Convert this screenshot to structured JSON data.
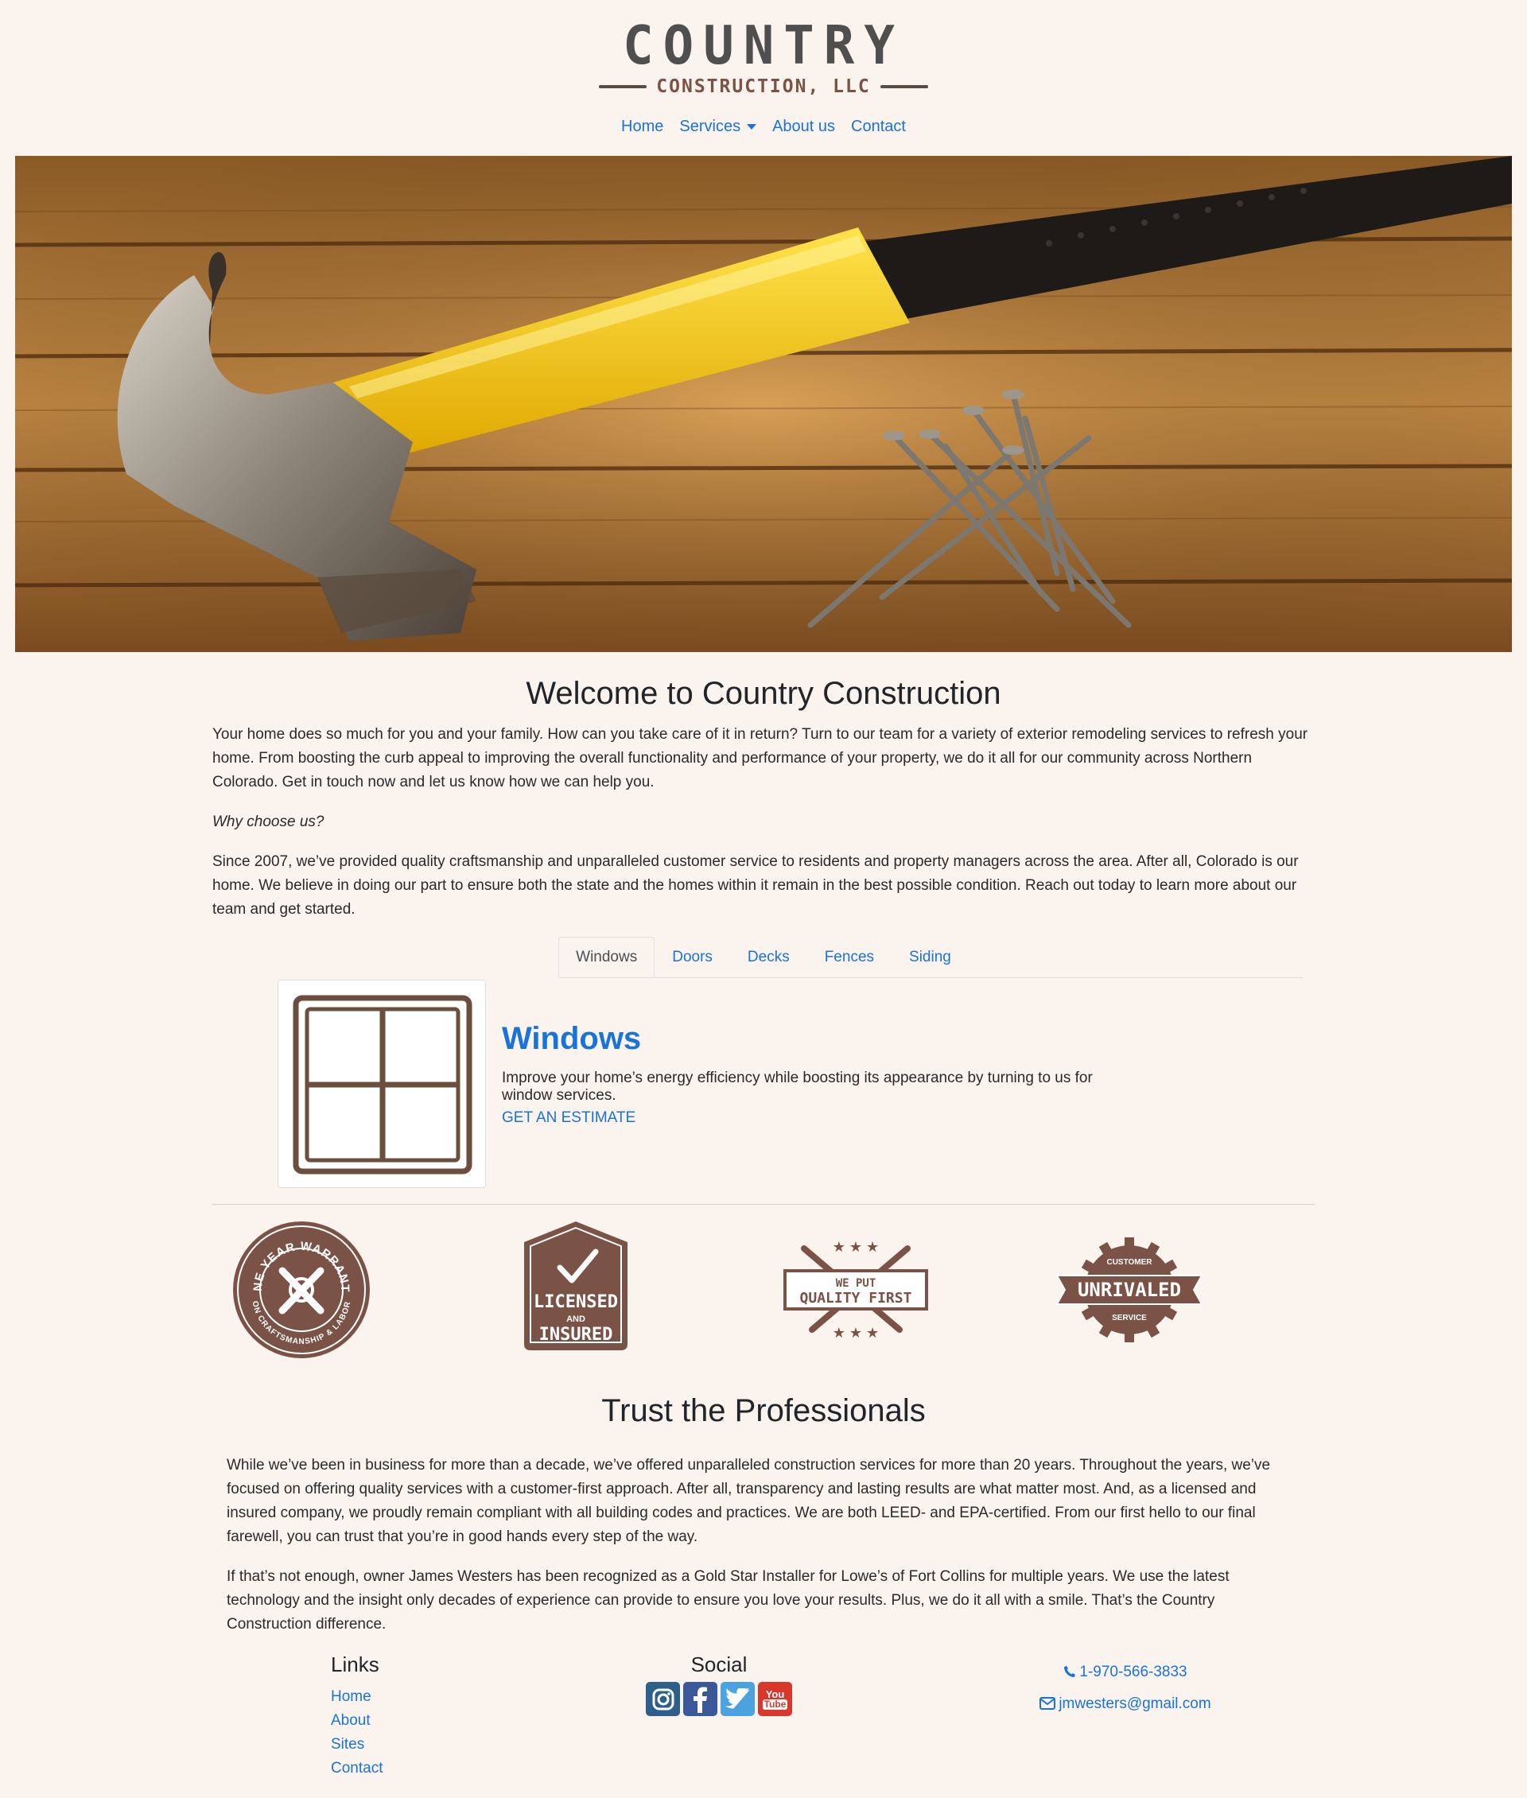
{
  "logo": {
    "main": "COUNTRY",
    "sub": "CONSTRUCTION, LLC"
  },
  "nav": {
    "home": "Home",
    "services": "Services",
    "about": "About us",
    "contact": "Contact"
  },
  "welcome": {
    "title": "Welcome to Country Construction",
    "intro": "Your home does so much for you and your family. How can you take care of it in return? Turn to our team for a variety of exterior remodeling services to refresh your home. From boosting the curb appeal to improving the overall functionality and performance of your property, we do it all for our community across Northern Colorado. Get in touch now and let us know how we can help you.",
    "why": "Why choose us?",
    "since": "Since 2007, we’ve provided quality craftsmanship and unparalleled customer service to residents and property managers across the area. After all, Colorado is our home. We believe in doing our part to ensure both the state and the homes within it remain in the best possible condition. Reach out today to learn more about our team and get started."
  },
  "tabs": [
    "Windows",
    "Doors",
    "Decks",
    "Fences",
    "Siding"
  ],
  "card": {
    "title": "Windows",
    "text": "Improve your home’s energy efficiency while boosting its appearance by turning to us for window services.",
    "link": "GET AN ESTIMATE"
  },
  "badges": {
    "warranty_top": "ONE YEAR WARRANTY",
    "warranty_bottom": "ON CRAFTSMANSHIP & LABOR",
    "licensed": "LICENSED",
    "and": "AND",
    "insured": "INSURED",
    "we_put": "WE PUT",
    "quality_first": "QUALITY FIRST",
    "customer": "CUSTOMER",
    "unrivaled": "UNRIVALED",
    "service": "SERVICE"
  },
  "trust": {
    "title": "Trust the Professionals",
    "p1": "While we’ve been in business for more than a decade, we’ve offered unparalleled construction services for more than 20 years. Throughout the years, we’ve focused on offering quality services with a customer-first approach. After all, transparency and lasting results are what matter most. And, as a licensed and insured company, we proudly remain compliant with all building codes and practices. We are both LEED- and EPA-certified. From our first hello to our final farewell, you can trust that you’re in good hands every step of the way.",
    "p2": "If that’s not enough, owner James Westers has been recognized as a Gold Star Installer for Lowe’s of Fort Collins for multiple years. We use the latest technology and the insight only decades of experience can provide to ensure you love your results. Plus, we do it all with a smile. That’s the Country Construction difference."
  },
  "footer": {
    "links_heading": "Links",
    "links": [
      "Home",
      "About",
      "Sites",
      "Contact"
    ],
    "social_heading": "Social",
    "youtube_you": "You",
    "youtube_tube": "Tube",
    "phone": "1-970-566-3833",
    "email": "jmwesters@gmail.com"
  },
  "colors": {
    "background": "#faf3ee",
    "link": "#1a73d9",
    "brand_brown": "#7a5246"
  }
}
